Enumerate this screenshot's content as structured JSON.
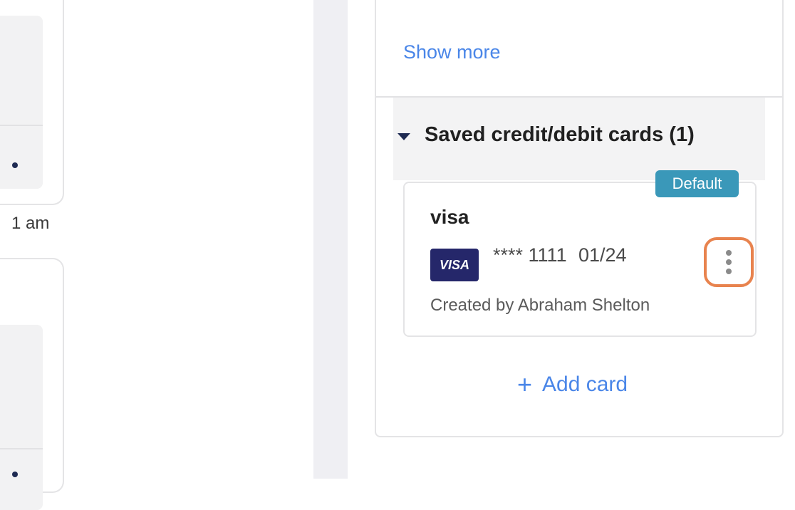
{
  "left_panel": {
    "time_partial": "1 am"
  },
  "payment_panel": {
    "show_more_label": "Show more",
    "saved_cards_title": "Saved credit/debit cards (1)",
    "cards": [
      {
        "name": "visa",
        "badge": "Default",
        "brand_logo_text": "VISA",
        "masked_number": "**** 1111",
        "expiry": "01/24",
        "created_by": "Created by Abraham Shelton"
      }
    ],
    "add_card_label": "Add card"
  },
  "colors": {
    "link_blue": "#4a86e8",
    "badge_teal": "#3a98b9",
    "visa_navy": "#25276a",
    "highlight_orange": "#e8834e"
  },
  "icons": {
    "caret": "caret-down-icon",
    "more": "more-vertical-icon",
    "add": "plus-icon"
  }
}
